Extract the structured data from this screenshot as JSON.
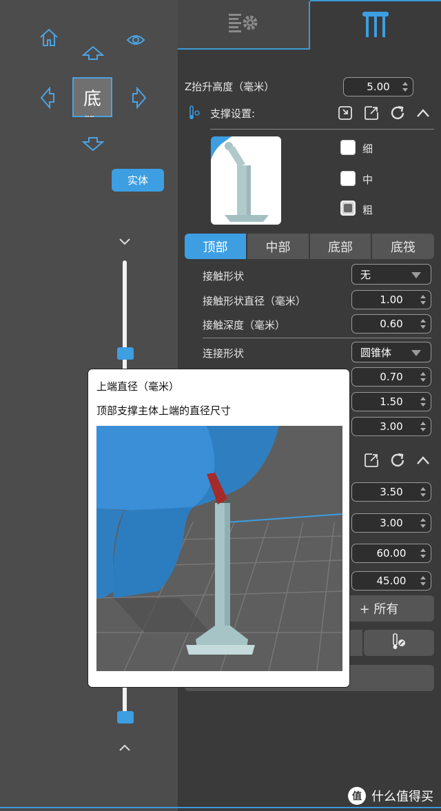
{
  "view": {
    "cube_face": "底",
    "solid_label": "实体"
  },
  "z_lift": {
    "label": "Z抬升高度（毫米）",
    "value": "5.00"
  },
  "support_settings": {
    "label": "支撑设置:",
    "sizes": [
      {
        "label": "细",
        "checked": false
      },
      {
        "label": "中",
        "checked": false
      },
      {
        "label": "粗",
        "checked": true
      }
    ]
  },
  "part_tabs": [
    "顶部",
    "中部",
    "底部",
    "底筏"
  ],
  "fields": {
    "contact_shape": {
      "label": "接触形状",
      "value": "无"
    },
    "contact_diameter": {
      "label": "接触形状直径（毫米）",
      "value": "1.00"
    },
    "contact_depth": {
      "label": "接触深度（毫米）",
      "value": "0.60"
    },
    "connect_shape": {
      "label": "连接形状",
      "value": "圆锥体"
    },
    "v1": "0.70",
    "v2": "1.50",
    "v3": "3.00",
    "v4": "3.50",
    "v5": "3.00",
    "v6": "60.00",
    "v7": "45.00"
  },
  "add_all_label": "+ 所有",
  "tooltip": {
    "title": "上端直径（毫米）",
    "description": "顶部支撑主体上端的直径尺寸"
  },
  "watermark": {
    "text": "什么值得买",
    "logo": "值"
  },
  "colors": {
    "accent": "#3d9ee2",
    "tab_border": "#3c9ad8"
  }
}
